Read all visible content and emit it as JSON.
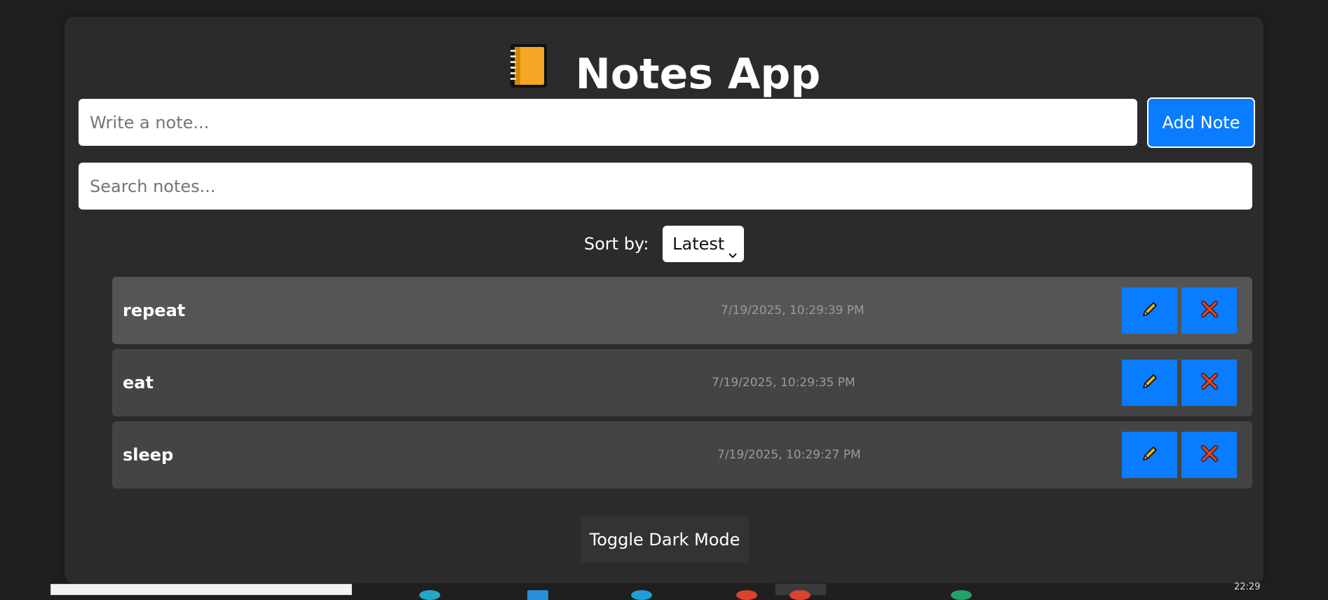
{
  "app": {
    "title": "Notes App",
    "title_icon": "notebook-icon",
    "note_input_placeholder": "Write a note...",
    "add_button_label": "Add Note",
    "search_placeholder": "Search notes...",
    "sort": {
      "label": "Sort by:",
      "selected": "Latest"
    },
    "toggle_label": "Toggle Dark Mode"
  },
  "notes": [
    {
      "text": "repeat",
      "timestamp": "7/19/2025, 10:29:39 PM"
    },
    {
      "text": "eat",
      "timestamp": "7/19/2025, 10:29:35 PM"
    },
    {
      "text": "sleep",
      "timestamp": "7/19/2025, 10:29:27 PM"
    }
  ],
  "icons": {
    "edit": "pencil-icon",
    "delete": "close-icon"
  },
  "colors": {
    "accent": "#0a7cff",
    "background": "#1f1f1f",
    "container": "#2b2b2b"
  },
  "taskbar": {
    "clock": "22:29"
  }
}
